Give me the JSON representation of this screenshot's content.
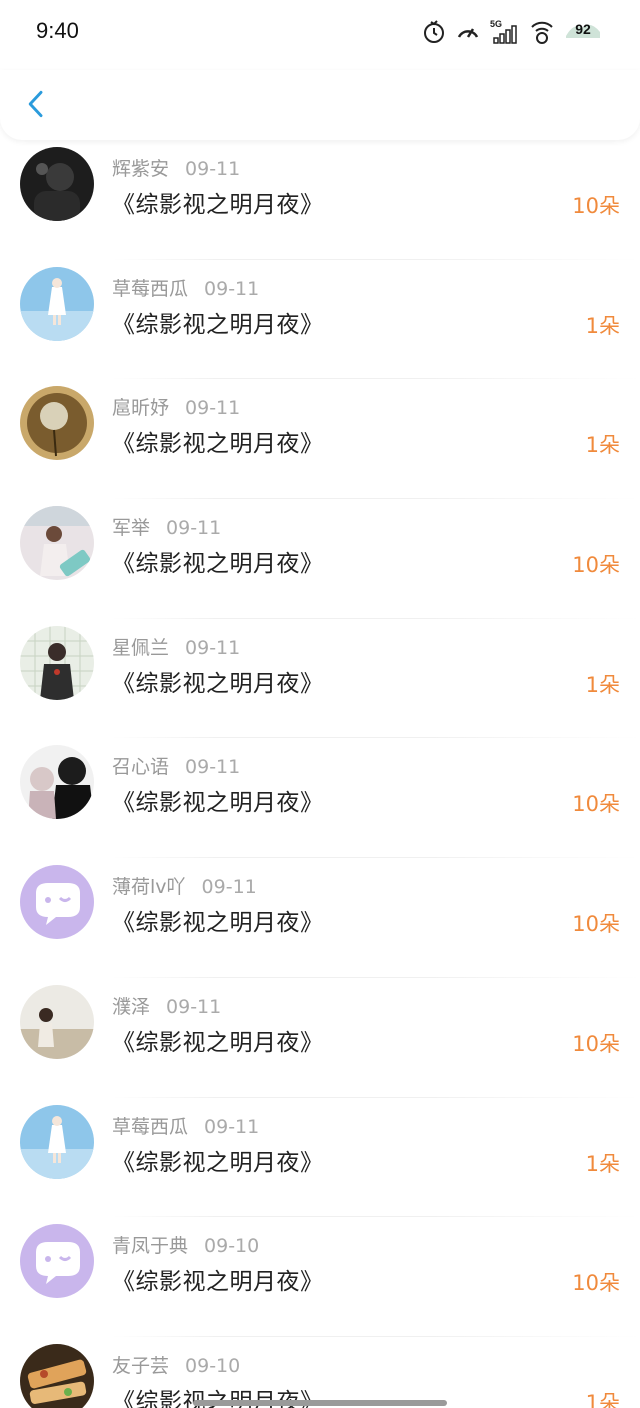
{
  "status_bar": {
    "time": "9:40",
    "network": "5G",
    "battery": "92",
    "icons": [
      "timer-icon",
      "speed-icon",
      "signal-5g-icon",
      "wifi-icon",
      "battery-icon"
    ]
  },
  "nav": {
    "back_icon": "chevron-left-icon",
    "accent_color": "#2a9bdc"
  },
  "colors": {
    "amount": "#f08a3c",
    "username": "#999999",
    "title": "#222222"
  },
  "items": [
    {
      "user": "辉紫安",
      "date": "09-11",
      "title": "《综影视之明月夜》",
      "amount": "10朵",
      "avatar": "dark-photo"
    },
    {
      "user": "草莓西瓜",
      "date": "09-11",
      "title": "《综影视之明月夜》",
      "amount": "1朵",
      "avatar": "sky-girl"
    },
    {
      "user": "扈昕妤",
      "date": "09-11",
      "title": "《综影视之明月夜》",
      "amount": "1朵",
      "avatar": "dandelion"
    },
    {
      "user": "军举",
      "date": "09-11",
      "title": "《综影视之明月夜》",
      "amount": "10朵",
      "avatar": "girl-room"
    },
    {
      "user": "星佩兰",
      "date": "09-11",
      "title": "《综影视之明月夜》",
      "amount": "1朵",
      "avatar": "girl-grid"
    },
    {
      "user": "召心语",
      "date": "09-11",
      "title": "《综影视之明月夜》",
      "amount": "10朵",
      "avatar": "couple"
    },
    {
      "user": "薄荷lv吖",
      "date": "09-11",
      "title": "《综影视之明月夜》",
      "amount": "10朵",
      "avatar": "chat-default"
    },
    {
      "user": "濮泽",
      "date": "09-11",
      "title": "《综影视之明月夜》",
      "amount": "10朵",
      "avatar": "beach-girl"
    },
    {
      "user": "草莓西瓜",
      "date": "09-11",
      "title": "《综影视之明月夜》",
      "amount": "1朵",
      "avatar": "sky-girl"
    },
    {
      "user": "青凤于典",
      "date": "09-10",
      "title": "《综影视之明月夜》",
      "amount": "10朵",
      "avatar": "chat-default"
    },
    {
      "user": "友子芸",
      "date": "09-10",
      "title": "《综影视之明月夜》",
      "amount": "1朵",
      "avatar": "food"
    }
  ]
}
